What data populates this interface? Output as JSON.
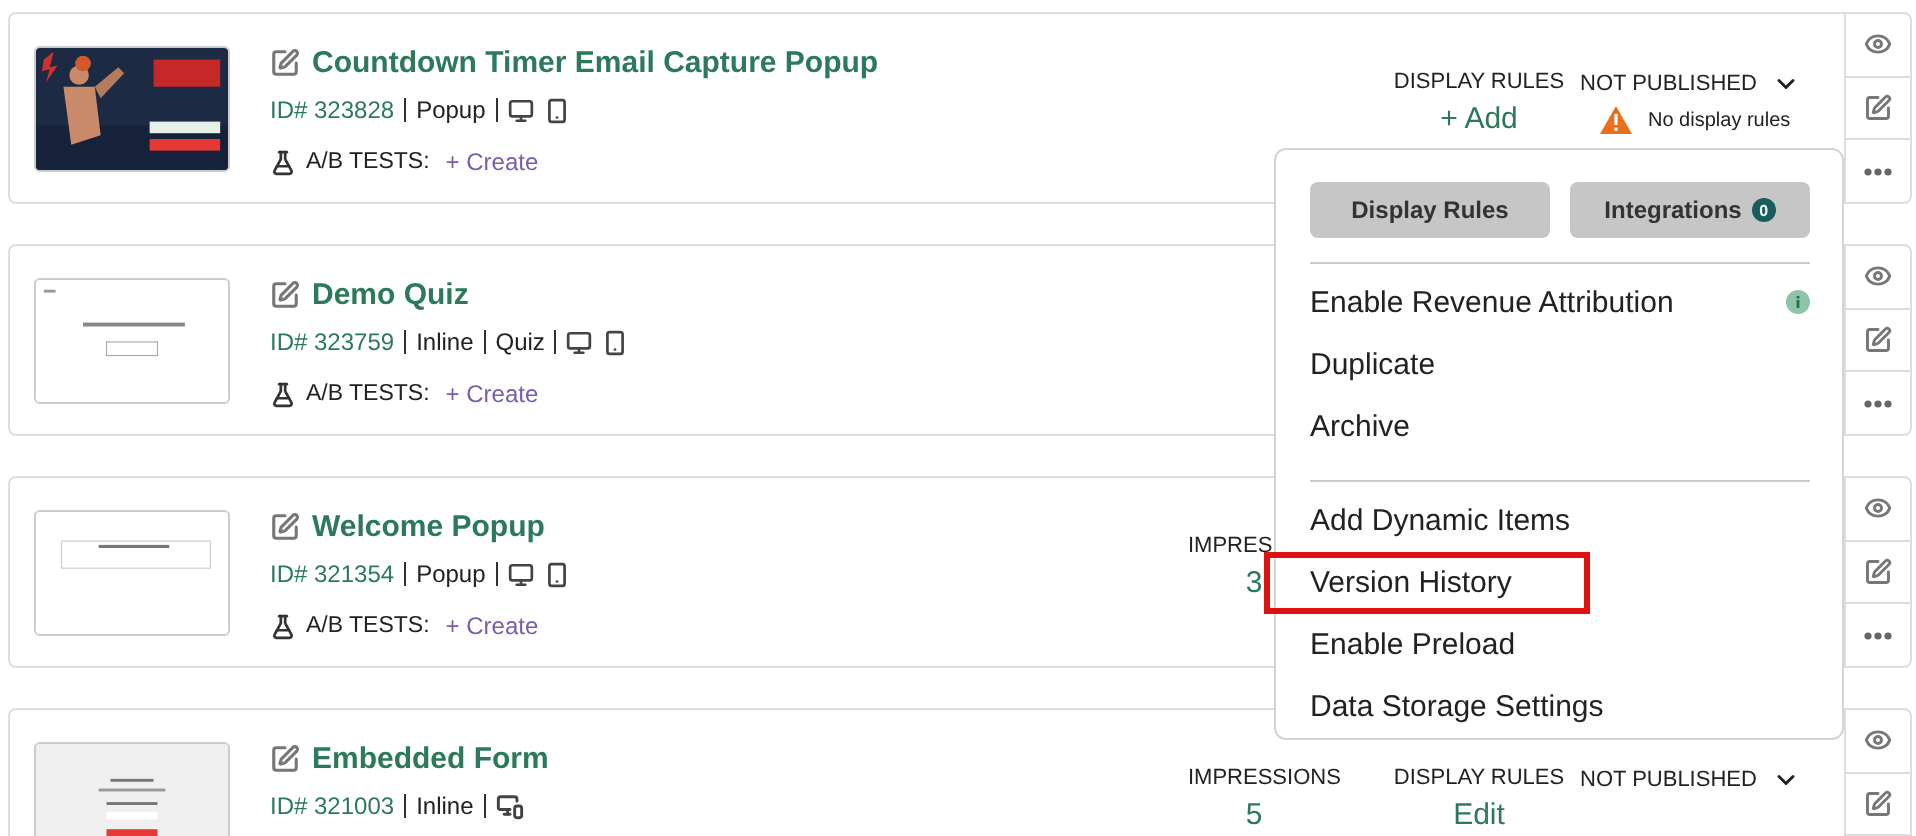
{
  "campaigns": [
    {
      "title": "Countdown Timer Email Capture Popup",
      "id": "ID# 323828",
      "tags": [
        "Popup"
      ],
      "devices": [
        {
          "kind": "desktop"
        },
        {
          "kind": "mobile"
        }
      ],
      "ab_label": "A/B TESTS:",
      "ab_action": "+ Create",
      "thumbnail": {
        "kind": "picture"
      },
      "stats": [
        {
          "kind": "rules",
          "label": "DISPLAY RULES",
          "value": "+ Add"
        },
        {
          "kind": "status",
          "label": "NOT PUBLISHED",
          "value": "No display rules",
          "warning": true
        }
      ]
    },
    {
      "title": "Demo Quiz",
      "id": "ID# 323759",
      "tags": [
        "Inline",
        "Quiz"
      ],
      "devices": [
        {
          "kind": "desktop"
        },
        {
          "kind": "mobile"
        }
      ],
      "ab_label": "A/B TESTS:",
      "ab_action": "+ Create",
      "thumbnail": {
        "kind": "picture"
      }
    },
    {
      "title": "Welcome Popup",
      "id": "ID# 321354",
      "tags": [
        "Popup"
      ],
      "devices": [
        {
          "kind": "desktop"
        },
        {
          "kind": "mobile"
        }
      ],
      "ab_label": "A/B TESTS:",
      "ab_action": "+ Create",
      "thumbnail": {
        "kind": "picture"
      },
      "stats": [
        {
          "kind": "metric",
          "label": "IMPRES",
          "value": "3"
        }
      ]
    },
    {
      "title": "Embedded Form",
      "id": "ID# 321003",
      "tags": [
        "Inline"
      ],
      "devices": [
        {
          "kind": "responsive"
        }
      ],
      "thumbnail": {
        "kind": "picture"
      },
      "stats": [
        {
          "kind": "metric",
          "label": "IMPRESSIONS",
          "value": "5"
        },
        {
          "kind": "rules",
          "label": "DISPLAY RULES",
          "value": "Edit"
        },
        {
          "kind": "status",
          "label": "NOT PUBLISHED",
          "warning": false
        }
      ]
    }
  ],
  "menu": {
    "buttons": [
      {
        "label": "Display Rules"
      },
      {
        "label": "Integrations",
        "badge": "0"
      }
    ],
    "sections": [
      [
        {
          "label": "Enable Revenue Attribution",
          "info": true,
          "highlighted": false
        },
        {
          "label": "Duplicate",
          "info": false,
          "highlighted": false
        },
        {
          "label": "Archive",
          "info": false,
          "highlighted": false
        }
      ],
      [
        {
          "label": "Add Dynamic Items",
          "info": false,
          "highlighted": false
        },
        {
          "label": "Version History",
          "info": false,
          "highlighted": true
        },
        {
          "label": "Enable Preload",
          "info": false,
          "highlighted": false
        },
        {
          "label": "Data Storage Settings",
          "info": false,
          "highlighted": false
        }
      ]
    ]
  }
}
